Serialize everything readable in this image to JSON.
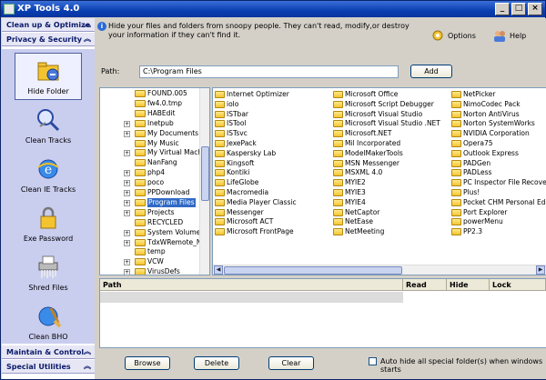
{
  "window": {
    "title": "XP Tools 4.0",
    "minimize": "_",
    "maximize": "□",
    "close": "×"
  },
  "sidebar": {
    "sections": [
      {
        "label": "Clean up & Optimize",
        "chevron": "︽"
      },
      {
        "label": "Privacy & Security",
        "chevron": "︽"
      },
      {
        "label": "Maintain & Control",
        "chevron": "︽"
      },
      {
        "label": "Special Utilities",
        "chevron": "︽"
      }
    ],
    "tools": [
      {
        "label": "Hide Folder",
        "icon": "hide-folder-icon",
        "selected": true
      },
      {
        "label": "Clean Tracks",
        "icon": "clean-tracks-icon"
      },
      {
        "label": "Clean IE Tracks",
        "icon": "clean-ie-tracks-icon"
      },
      {
        "label": "Exe Password",
        "icon": "exe-password-icon"
      },
      {
        "label": "Shred Files",
        "icon": "shred-files-icon"
      },
      {
        "label": "Clean BHO",
        "icon": "clean-bho-icon"
      }
    ]
  },
  "header": {
    "description": "Hide your files and folders from snoopy people. They can't read, modify,or destroy your information if they can't find it.",
    "options_label": "Options",
    "help_label": "Help"
  },
  "path": {
    "label": "Path:",
    "value": "C:\\Program Files",
    "add_label": "Add"
  },
  "tree": {
    "items": [
      {
        "label": "FOUND.005",
        "expander": ""
      },
      {
        "label": "fw4.0.tmp",
        "expander": ""
      },
      {
        "label": "HABEdit",
        "expander": ""
      },
      {
        "label": "Inetpub",
        "expander": "+"
      },
      {
        "label": "My Documents",
        "expander": "+"
      },
      {
        "label": "My Music",
        "expander": ""
      },
      {
        "label": "My Virtual Machin",
        "expander": "+"
      },
      {
        "label": "NanFang",
        "expander": ""
      },
      {
        "label": "php4",
        "expander": "+"
      },
      {
        "label": "poco",
        "expander": "+"
      },
      {
        "label": "PPDownload",
        "expander": "+"
      },
      {
        "label": "Program Files",
        "expander": "+",
        "selected": true
      },
      {
        "label": "Projects",
        "expander": "+"
      },
      {
        "label": "RECYCLED",
        "expander": ""
      },
      {
        "label": "System Volume In",
        "expander": "+"
      },
      {
        "label": "TdxWRemote_N",
        "expander": "+"
      },
      {
        "label": "temp",
        "expander": ""
      },
      {
        "label": "VCW",
        "expander": "+"
      },
      {
        "label": "VirusDefs",
        "expander": "+"
      }
    ]
  },
  "files": {
    "col1": [
      "Internet Optimizer",
      "iolo",
      "ISTbar",
      "ISTool",
      "ISTsvc",
      "JexePack",
      "Kaspersky Lab",
      "Kingsoft",
      "Kontiki",
      "LifeGlobe",
      "Macromedia",
      "Media Player Classic",
      "Messenger",
      "Microsoft ACT",
      "Microsoft FrontPage"
    ],
    "col2": [
      "Microsoft Office",
      "Microsoft Script Debugger",
      "Microsoft Visual Studio",
      "Microsoft Visual Studio .NET",
      "Microsoft.NET",
      "Mil Incorporated",
      "ModelMakerTools",
      "MSN Messenger",
      "MSXML 4.0",
      "MYIE2",
      "MYIE3",
      "MYIE4",
      "NetCaptor",
      "NetEase",
      "NetMeeting"
    ],
    "col3": [
      "NetPicker",
      "NimoCodec Pack",
      "Norton AntiVirus",
      "Norton SystemWorks",
      "NVIDIA Corporation",
      "Opera75",
      "Outlook Express",
      "PADGen",
      "PADLess",
      "PC Inspector File Recovery",
      "Plus!",
      "Pocket CHM Personal Editi",
      "Port Explorer",
      "powerMenu",
      "PP2.3"
    ]
  },
  "grid": {
    "headers": [
      "Path",
      "Read",
      "Hide",
      "Lock"
    ]
  },
  "bottom": {
    "browse_label": "Browse",
    "delete_label": "Delete",
    "clear_label": "Clear",
    "auto_hide_label": "Auto hide all special folder(s) when windows starts"
  },
  "colors": {
    "accent": "#0a3fb0",
    "selection": "#316ac5",
    "sidebar_bg": "#c9cdee"
  }
}
